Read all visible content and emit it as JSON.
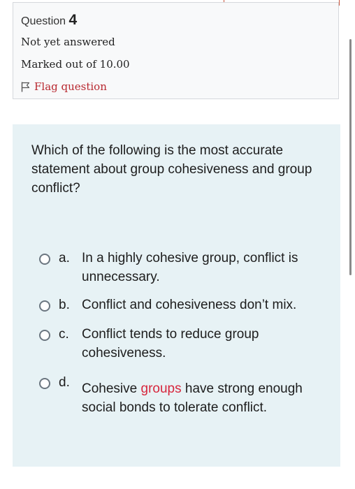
{
  "info": {
    "question_label": "Question",
    "question_number": "4",
    "status": "Not yet answered",
    "marked_out": "Marked out of 10.00",
    "flag_label": "Flag question"
  },
  "question": {
    "text": "Which of the following is the most accurate statement about group cohesiveness and group conflict?"
  },
  "answers": [
    {
      "letter": "a.",
      "text": "In a highly cohesive group, conflict is unnecessary."
    },
    {
      "letter": "b.",
      "text": "Conflict and cohesiveness don’t mix."
    },
    {
      "letter": "c.",
      "text": "Conflict tends to reduce group cohesiveness."
    },
    {
      "letter": "d.",
      "text_before": "Cohesive ",
      "text_highlight": "groups",
      "text_after": " have strong enough social bonds to tolerate conflict."
    }
  ],
  "colors": {
    "flag": "#b8282f",
    "highlight": "#d7263d",
    "content_bg": "#e7f2f5"
  }
}
